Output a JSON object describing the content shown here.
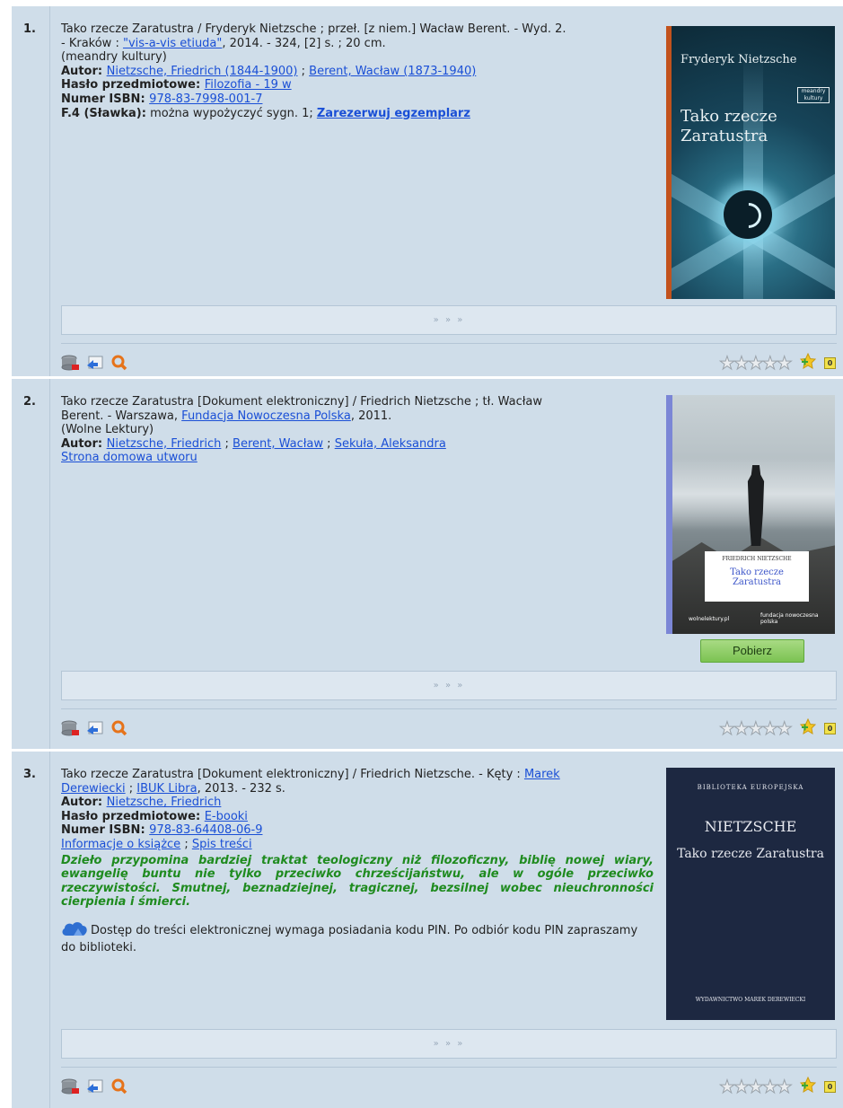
{
  "entries": [
    {
      "number": "1.",
      "desc_line1": "Tako rzecze Zaratustra / Fryderyk Nietzsche ; przeł. [z niem.] Wacław Berent. - Wyd. 2.",
      "desc_line2_pre": "- Kraków : ",
      "publisher_link": "\"vis-a-vis etiuda\"",
      "desc_line2_post": ", 2014. - 324, [2] s. ; 20 cm.",
      "series": "(meandry kultury)",
      "author_label": "Autor",
      "author_links": [
        "Nietzsche, Friedrich (1844-1900)",
        "Berent, Wacław (1873-1940)"
      ],
      "subject_label": "Hasło przedmiotowe",
      "subject_link": "Filozofia - 19 w",
      "isbn_label": "Numer ISBN",
      "isbn_link": "978-83-7998-001-7",
      "branch_label": "F.4 (Sławka):",
      "branch_text": "można wypożyczyć sygn. 1; ",
      "reserve_link": "Zarezerwuj egzemplarz",
      "cover": {
        "author": "Fryderyk Nietzsche",
        "title": "Tako rzecze Zaratustra",
        "badge": "meandry kultury"
      },
      "more": "» » »"
    },
    {
      "number": "2.",
      "desc_line1": "Tako rzecze Zaratustra [Dokument elektroniczny] / Friedrich Nietzsche ; tł. Wacław",
      "desc_line2_pre": "Berent. - Warszawa, ",
      "publisher_link": "Fundacja Nowoczesna Polska",
      "desc_line2_post": ", 2011.",
      "series": "(Wolne Lektury)",
      "author_label": "Autor",
      "author_links": [
        "Nietzsche, Friedrich",
        "Berent, Wacław",
        "Sekuła, Aleksandra"
      ],
      "homepage_link": "Strona domowa utworu",
      "cover": {
        "author": "FRIEDRICH NIETZSCHE",
        "title": "Tako rzecze Zaratustra",
        "logo1": "wolnelektury.pl",
        "logo2": "fundacja nowoczesna polska"
      },
      "download": "Pobierz",
      "more": "» » »"
    },
    {
      "number": "3.",
      "desc_line1_pre": "Tako rzecze Zaratustra [Dokument elektroniczny] / Friedrich Nietzsche. - Kęty : ",
      "publisher_link1_a": "Marek",
      "publisher_link1_b": "Derewiecki",
      "sep": " ; ",
      "publisher_link2": "IBUK Libra",
      "desc_line2_post": ", 2013. - 232 s.",
      "author_label": "Autor",
      "author_link": "Nietzsche, Friedrich",
      "subject_label": "Hasło przedmiotowe",
      "subject_link": "E-booki",
      "isbn_label": "Numer ISBN",
      "isbn_link": "978-83-64408-06-9",
      "info_link": "Informacje o książce",
      "toc_link": "Spis treści",
      "blurb": "Dzieło przypomina bardziej traktat teologiczny niż filozoficzny, biblię nowej wiary, ewangelię buntu nie tylko przeciwko chrześcijaństwu, ale w ogóle przeciwko rzeczywistości. Smutnej, beznadziejnej, tragicznej, bezsilnej wobec nieuchronności cierpienia i śmierci.",
      "pin_note": "Dostęp do treści elektronicznej wymaga posiadania kodu PIN. Po odbiór kodu PIN zapraszamy do biblioteki.",
      "cover": {
        "series": "BIBLIOTEKA EUROPEJSKA",
        "author": "NIETZSCHE",
        "title": "Tako rzecze Zaratustra",
        "publisher": "WYDAWNICTWO MAREK DEREWIECKI"
      },
      "more": "» » »"
    }
  ],
  "rating_zero": "0",
  "colors": {
    "row_bg": "#cfdde9",
    "link": "#1a4fd6",
    "blurb": "#1f8b1f",
    "button": "#8ccd62"
  }
}
